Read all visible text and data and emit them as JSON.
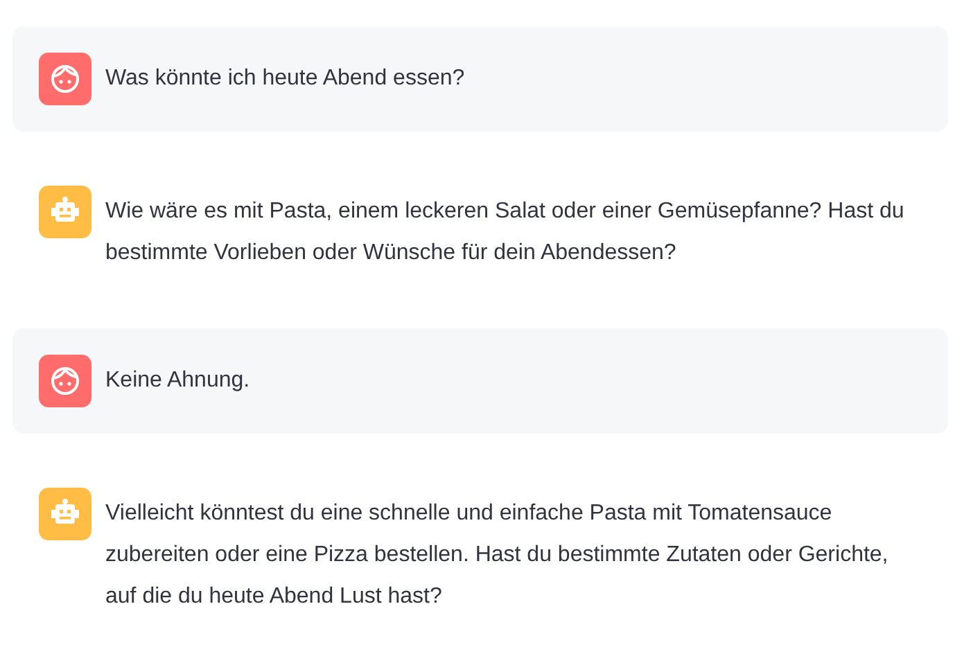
{
  "messages": [
    {
      "kind": "user",
      "text": "Was könnte ich heute Abend essen?"
    },
    {
      "kind": "assistant",
      "text": "Wie wäre es mit Pasta, einem leckeren Salat oder einer Gemüsepfanne? Hast du bestimmte Vorlieben oder Wünsche für dein Abendessen?"
    },
    {
      "kind": "user",
      "text": "Keine Ahnung."
    },
    {
      "kind": "assistant",
      "text": "Vielleicht könntest du eine schnelle und einfache Pasta mit Tomatensauce zubereiten oder eine Pizza bestellen. Hast du bestimmte Zutaten oder Gerichte, auf die du heute Abend Lust hast?"
    }
  ]
}
